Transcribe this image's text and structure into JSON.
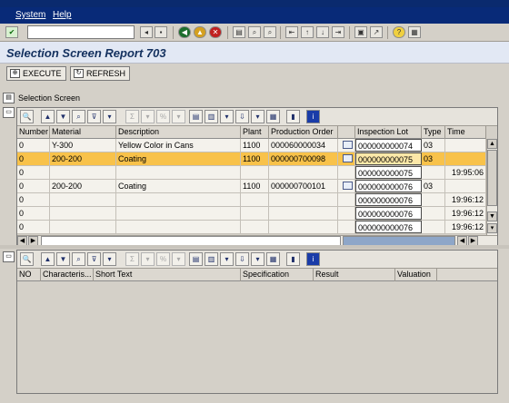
{
  "menu": {
    "system": "System",
    "help": "Help"
  },
  "title": "Selection Screen Report 703",
  "toolbar": {
    "execute": "EXECUTE",
    "refresh": "REFRESH"
  },
  "selection_title": "Selection Screen",
  "top_grid": {
    "headers": [
      "Number",
      "Material",
      "Description",
      "Plant",
      "Production Order",
      "",
      "Inspection Lot",
      "Type",
      "Time"
    ],
    "rows": [
      {
        "number": "0",
        "material": "Y-300",
        "description": "Yellow Color in Cans",
        "plant": "1100",
        "order": "000060000034",
        "lot": "000000000074",
        "type": "03",
        "time": "",
        "icon": true,
        "selected": false
      },
      {
        "number": "0",
        "material": "200-200",
        "description": "Coating",
        "plant": "1100",
        "order": "000000700098",
        "lot": "000000000075",
        "type": "03",
        "time": "",
        "icon": true,
        "selected": true
      },
      {
        "number": "0",
        "material": "",
        "description": "",
        "plant": "",
        "order": "",
        "lot": "000000000075",
        "type": "",
        "time": "19:95:06",
        "icon": false,
        "selected": false
      },
      {
        "number": "0",
        "material": "200-200",
        "description": "Coating",
        "plant": "1100",
        "order": "000000700101",
        "lot": "000000000076",
        "type": "03",
        "time": "",
        "icon": true,
        "selected": false
      },
      {
        "number": "0",
        "material": "",
        "description": "",
        "plant": "",
        "order": "",
        "lot": "000000000076",
        "type": "",
        "time": "19:96:12",
        "icon": false,
        "selected": false
      },
      {
        "number": "0",
        "material": "",
        "description": "",
        "plant": "",
        "order": "",
        "lot": "000000000076",
        "type": "",
        "time": "19:96:12",
        "icon": false,
        "selected": false
      },
      {
        "number": "0",
        "material": "",
        "description": "",
        "plant": "",
        "order": "",
        "lot": "000000000076",
        "type": "",
        "time": "19:96:12",
        "icon": false,
        "selected": false
      }
    ]
  },
  "bottom_grid": {
    "headers": [
      "NO",
      "Characteris...",
      "Short Text",
      "Specification",
      "Result",
      "Valuation"
    ]
  }
}
